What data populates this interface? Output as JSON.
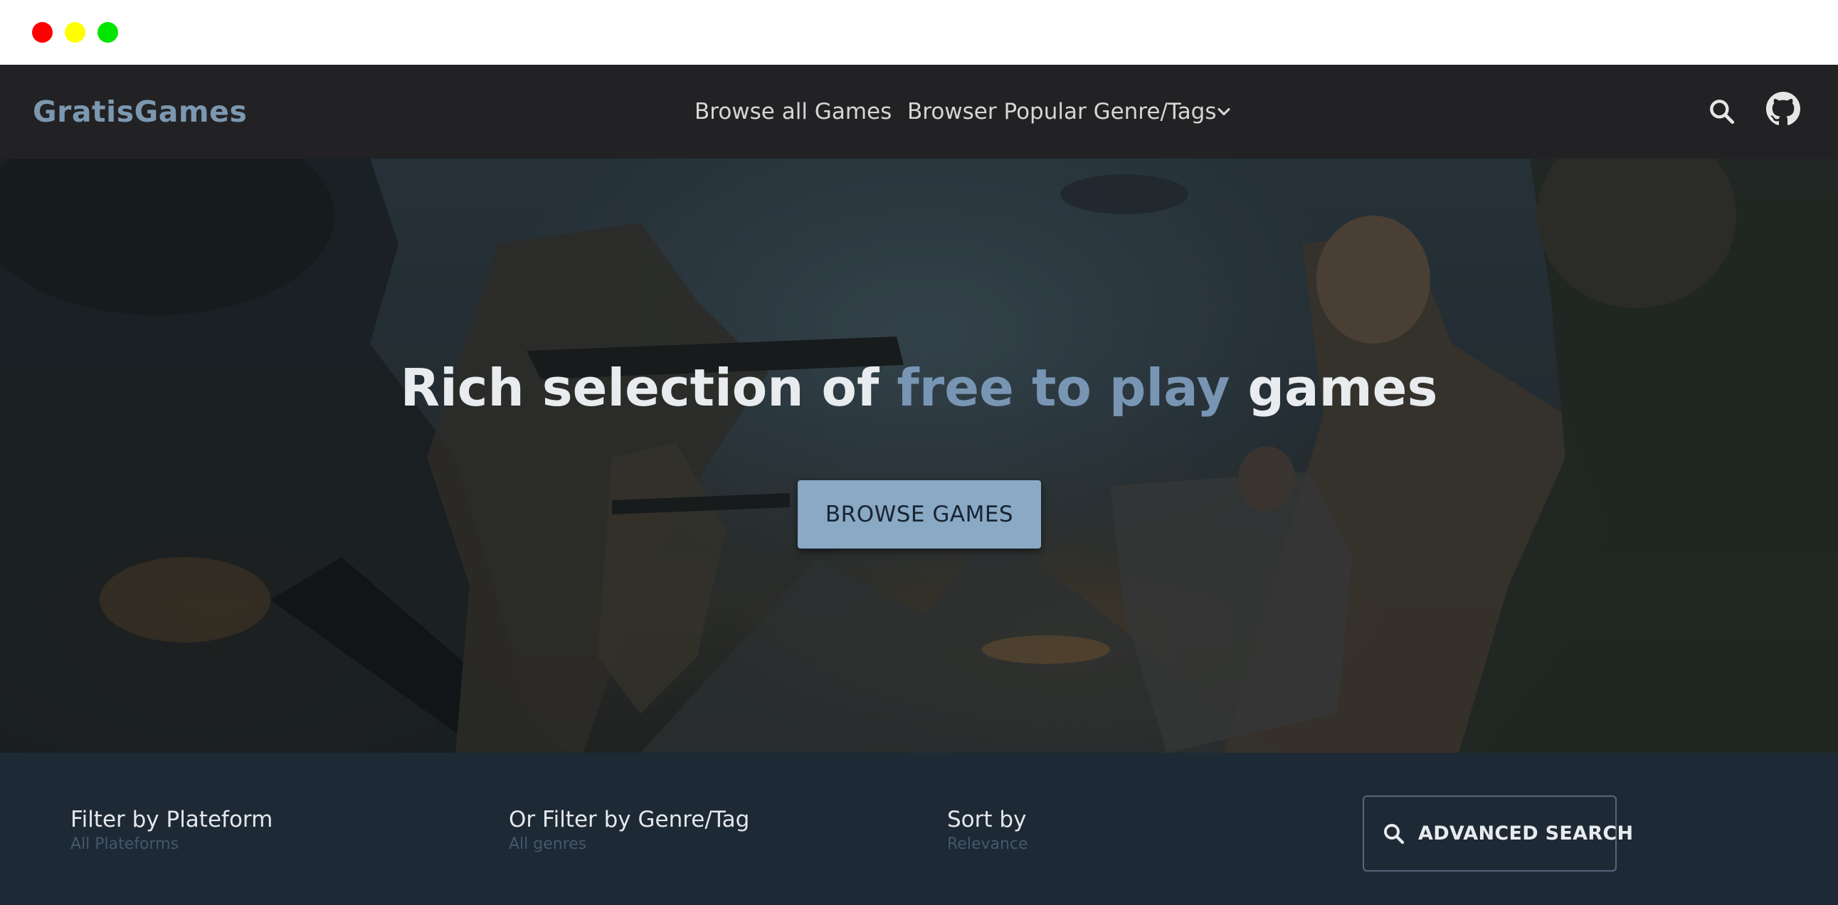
{
  "window": {
    "controls": [
      "close",
      "minimize",
      "maximize"
    ]
  },
  "navbar": {
    "logo": "GratisGames",
    "links": [
      {
        "label": "Browse all Games"
      },
      {
        "label": "Browser Popular Genre/Tags",
        "icon": "chevron-down-icon"
      }
    ],
    "icons": [
      "search-icon",
      "github-icon"
    ]
  },
  "hero": {
    "title_start": "Rich selection of ",
    "title_accent": "free to play",
    "title_end": " games",
    "button_label": "BROWSE GAMES",
    "accent_color": "#7896b3",
    "button_color": "#89a9c5"
  },
  "filters": {
    "platform": {
      "label": "Filter by Plateform",
      "value": "All Plateforms"
    },
    "genre": {
      "label": "Or Filter by Genre/Tag",
      "value": "All genres"
    },
    "sort": {
      "label": "Sort by",
      "value": "Relevance"
    },
    "advanced_search": {
      "label": "ADVANCED SEARCH",
      "icon": "search-icon"
    }
  },
  "colors": {
    "navbar_bg": "#222224",
    "filterbar_bg": "#1d2935",
    "logo": "#7c98b0"
  }
}
